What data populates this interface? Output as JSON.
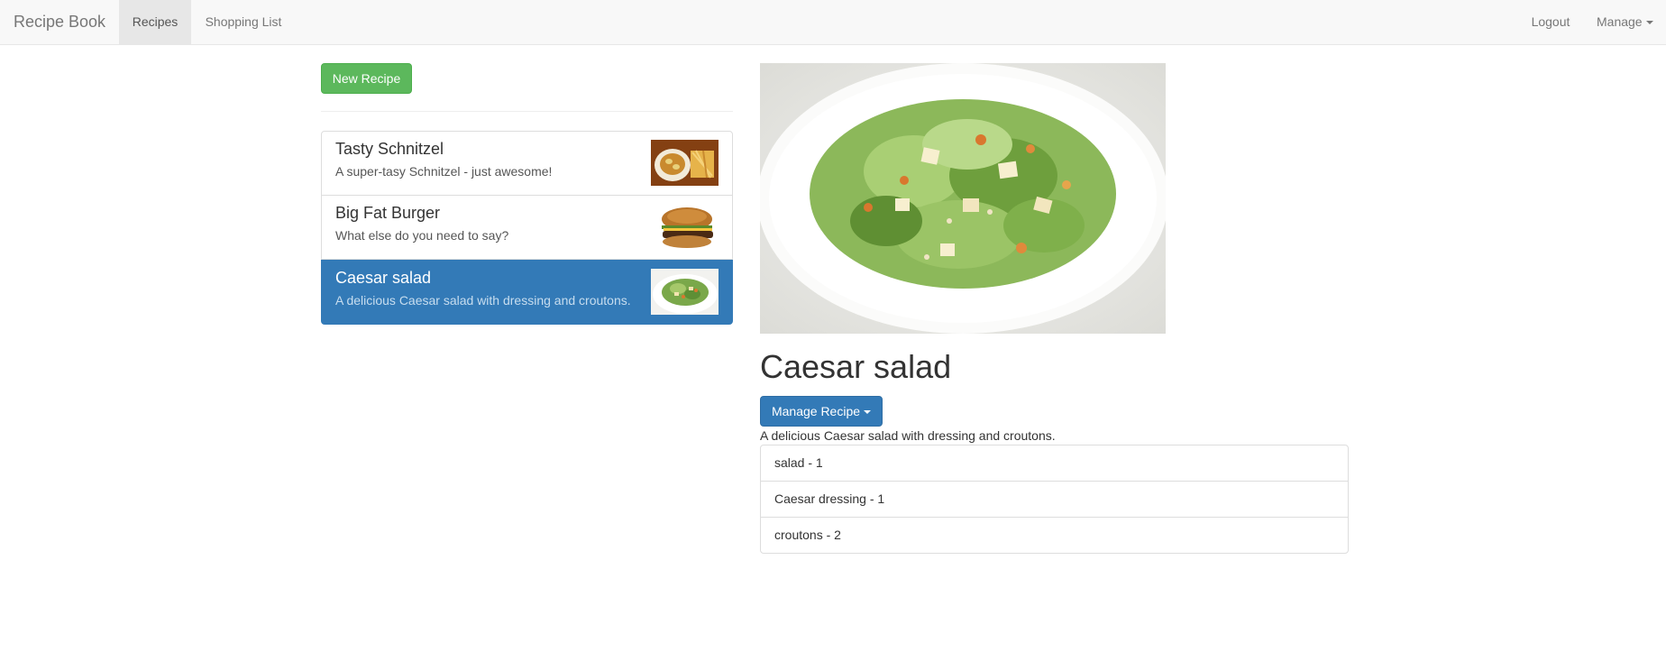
{
  "navbar": {
    "brand": "Recipe Book",
    "links": [
      {
        "label": "Recipes",
        "active": true
      },
      {
        "label": "Shopping List",
        "active": false
      }
    ],
    "right": {
      "logout": "Logout",
      "manage": "Manage"
    }
  },
  "recipe_list": {
    "new_button": "New Recipe",
    "items": [
      {
        "name": "Tasty Schnitzel",
        "description": "A super-tasy Schnitzel - just awesome!",
        "image": "schnitzel-photo",
        "active": false
      },
      {
        "name": "Big Fat Burger",
        "description": "What else do you need to say?",
        "image": "burger-photo",
        "active": false
      },
      {
        "name": "Caesar salad",
        "description": "A delicious Caesar salad with dressing and croutons.",
        "image": "salad-photo",
        "active": true
      }
    ]
  },
  "detail": {
    "image": "salad-photo",
    "title": "Caesar salad",
    "manage_button": "Manage Recipe",
    "description": "A delicious Caesar salad with dressing and croutons.",
    "ingredients": [
      {
        "text": "salad - 1"
      },
      {
        "text": "Caesar dressing - 1"
      },
      {
        "text": "croutons - 2"
      }
    ]
  },
  "colors": {
    "success": "#5cb85c",
    "primary": "#337ab7",
    "navbar_bg": "#f8f8f8"
  }
}
